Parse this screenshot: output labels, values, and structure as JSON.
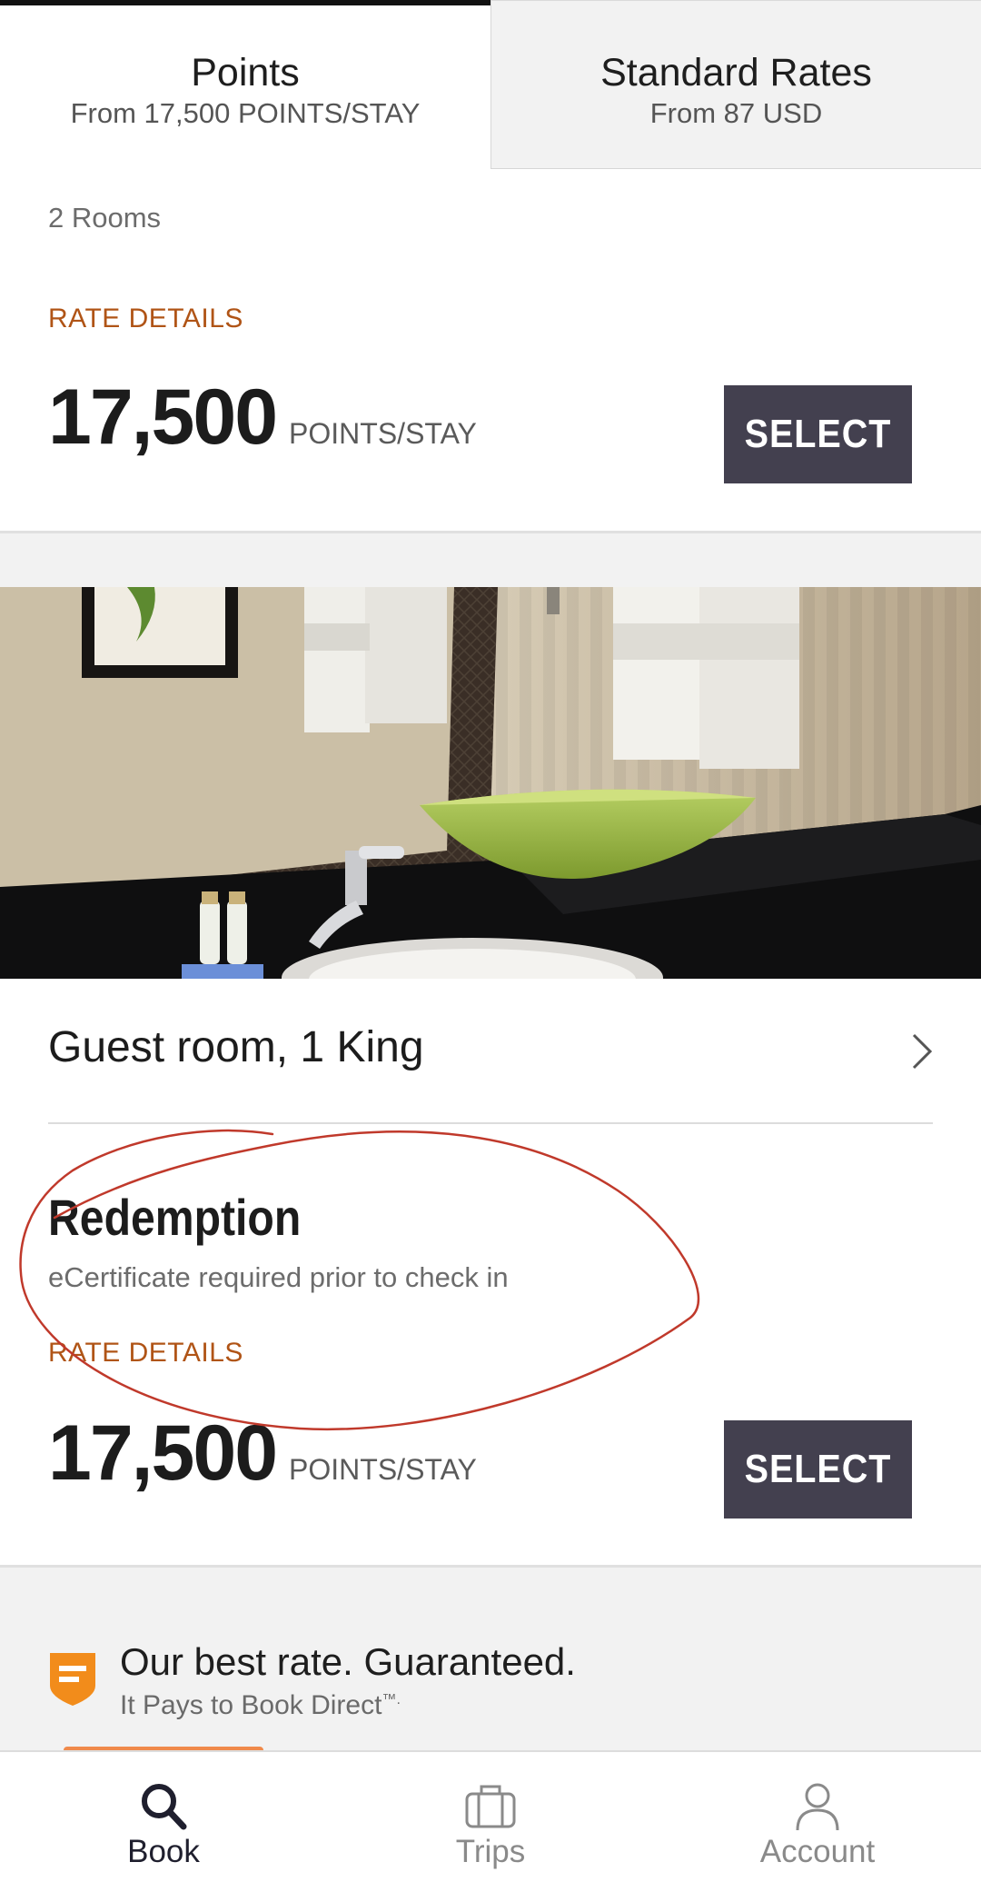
{
  "tabs": [
    {
      "title": "Points",
      "subtitle": "From 17,500 POINTS/STAY",
      "active": true
    },
    {
      "title": "Standard Rates",
      "subtitle": "From 87 USD",
      "active": false
    }
  ],
  "offer1": {
    "rooms": "2 Rooms",
    "rate_details": "RATE DETAILS",
    "price": "17,500",
    "unit": "POINTS/STAY",
    "select": "SELECT"
  },
  "room": {
    "name": "Guest room, 1 King"
  },
  "offer2": {
    "title": "Redemption",
    "subtitle": "eCertificate required prior to check in",
    "rate_details": "RATE DETAILS",
    "price": "17,500",
    "unit": "POINTS/STAY",
    "select": "SELECT"
  },
  "guarantee": {
    "title": "Our best rate. Guaranteed.",
    "subtitle": "It Pays to Book Direct",
    "trademark": "™."
  },
  "nav": {
    "book": "Book",
    "trips": "Trips",
    "account": "Account"
  },
  "colors": {
    "accent_orange": "#b05416",
    "button": "#43404f",
    "nav_indicator": "#f08a4b",
    "annotation": "#c0392b"
  },
  "icons": [
    "search-icon",
    "briefcase-icon",
    "person-icon",
    "chevron-right-icon",
    "shield-flag-icon"
  ]
}
